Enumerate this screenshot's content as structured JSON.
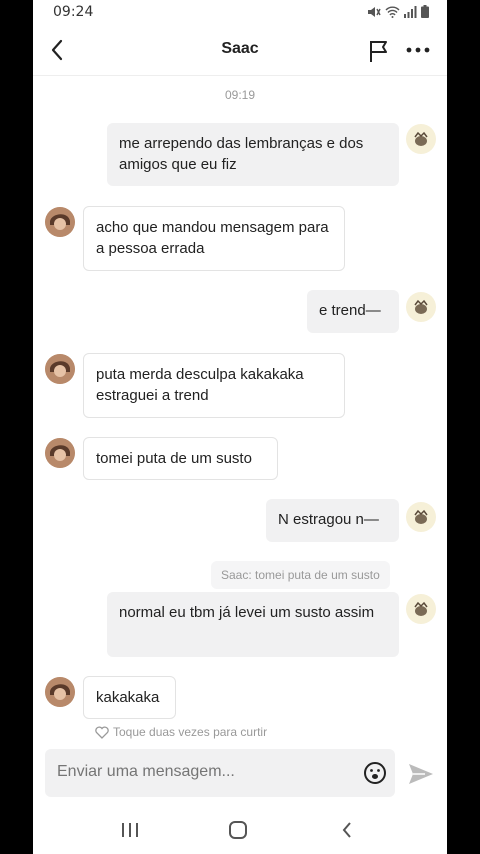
{
  "status_bar": {
    "time": "09:24"
  },
  "header": {
    "title": "Saac"
  },
  "timestamp": "09:19",
  "messages": [
    {
      "text": "me arrependo das lembranças e dos amigos que eu fiz"
    },
    {
      "text": "acho que mandou mensagem para a pessoa errada"
    },
    {
      "text": "e trend—"
    },
    {
      "text": "puta merda desculpa kakakaka estraguei a trend"
    },
    {
      "text": "tomei puta de um susto"
    },
    {
      "text": "N estragou n—"
    },
    {
      "text": "normal eu tbm já levei um susto assim"
    },
    {
      "text": "kakakaka"
    }
  ],
  "reply_preview": "Saac: tomei puta de um susto",
  "like_hint": "Toque duas vezes para curtir",
  "composer": {
    "placeholder": "Enviar uma mensagem..."
  },
  "colors": {
    "outgoing_bubble": "#f1f1f2",
    "incoming_border": "#e3e3e3"
  }
}
